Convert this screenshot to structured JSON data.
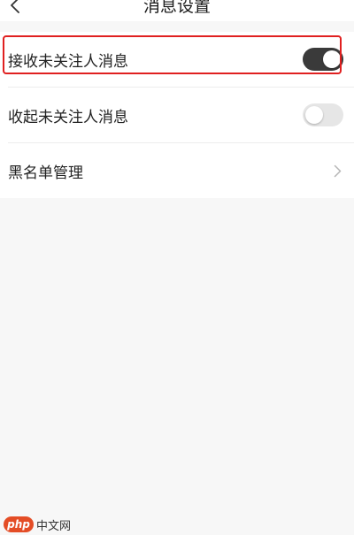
{
  "header": {
    "title": "消息设置",
    "back_icon": "chevron-left-icon"
  },
  "settings": {
    "items": [
      {
        "label": "接收未关注人消息",
        "control": "toggle",
        "enabled": true
      },
      {
        "label": "收起未关注人消息",
        "control": "toggle",
        "enabled": false
      },
      {
        "label": "黑名单管理",
        "control": "chevron",
        "icon": "chevron-right-icon"
      }
    ]
  },
  "watermark": {
    "logo_text": "php",
    "site_text": "中文网"
  },
  "colors": {
    "toggle_on": "#3a3a3a",
    "toggle_off": "#e6e6e6",
    "highlight_border": "#e02020",
    "watermark_logo": "#e44d26"
  }
}
